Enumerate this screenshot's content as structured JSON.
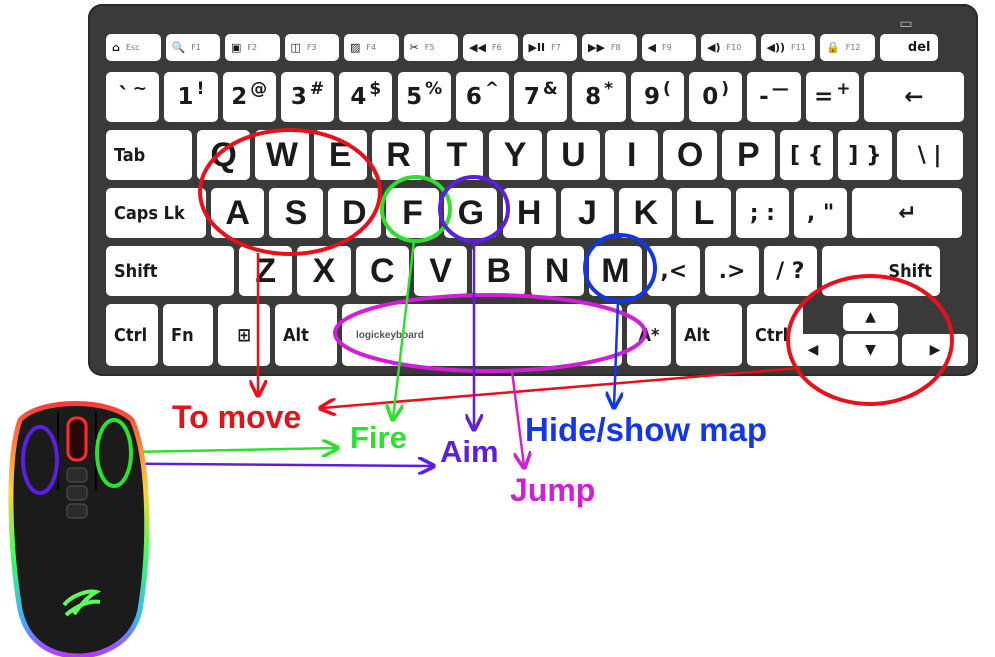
{
  "keyboard": {
    "brand": "logickeyboard",
    "function_row": [
      {
        "label": "⌂",
        "fn": "Esc",
        "icon": "home-icon"
      },
      {
        "label": "🔍",
        "fn": "F1",
        "icon": "search-icon"
      },
      {
        "label": "▣",
        "fn": "F2",
        "icon": "image-icon"
      },
      {
        "label": "◫",
        "fn": "F3",
        "icon": "window-icon"
      },
      {
        "label": "▨",
        "fn": "F4",
        "icon": "screen-edit-icon"
      },
      {
        "label": "✂",
        "fn": "F5",
        "icon": "scissors-icon"
      },
      {
        "label": "◀◀",
        "fn": "F6",
        "icon": "rewind-icon"
      },
      {
        "label": "▶II",
        "fn": "F7",
        "icon": "play-pause-icon"
      },
      {
        "label": "▶▶",
        "fn": "F8",
        "icon": "fast-forward-icon"
      },
      {
        "label": "◀",
        "fn": "F9",
        "icon": "mute-icon"
      },
      {
        "label": "◀)",
        "fn": "F10",
        "icon": "volume-down-icon"
      },
      {
        "label": "◀))",
        "fn": "F11",
        "icon": "volume-up-icon"
      },
      {
        "label": "🔒",
        "fn": "F12",
        "icon": "lock-icon"
      },
      {
        "label": "del",
        "fn": "",
        "icon": ""
      }
    ],
    "number_row": [
      {
        "main": "`",
        "shift": "~"
      },
      {
        "main": "1",
        "shift": "!"
      },
      {
        "main": "2",
        "shift": "@"
      },
      {
        "main": "3",
        "shift": "#"
      },
      {
        "main": "4",
        "shift": "$"
      },
      {
        "main": "5",
        "shift": "%"
      },
      {
        "main": "6",
        "shift": "^"
      },
      {
        "main": "7",
        "shift": "&"
      },
      {
        "main": "8",
        "shift": "*"
      },
      {
        "main": "9",
        "shift": "("
      },
      {
        "main": "0",
        "shift": ")"
      },
      {
        "main": "-",
        "shift": "—"
      },
      {
        "main": "=",
        "shift": "+"
      },
      {
        "main": "←",
        "shift": ""
      }
    ],
    "top_row": [
      "Tab",
      "Q",
      "W",
      "E",
      "R",
      "T",
      "Y",
      "U",
      "I",
      "O",
      "P",
      "[ {",
      "] }",
      "\\ |"
    ],
    "home_row": [
      "Caps Lk",
      "A",
      "S",
      "D",
      "F",
      "G",
      "H",
      "J",
      "K",
      "L",
      "; :",
      ", \"",
      "↵"
    ],
    "bottom_row": [
      "Shift",
      "Z",
      "X",
      "C",
      "V",
      "B",
      "N",
      "M",
      ",<",
      ".>",
      "/ ?",
      "Shift"
    ],
    "space_row": [
      "Ctrl",
      "Fn",
      "⊞",
      "Alt",
      "",
      "A*",
      "Alt",
      "Ctrl"
    ],
    "arrows": [
      "▲",
      "◀",
      "▼",
      "▶"
    ]
  },
  "annotations": {
    "move": {
      "text": "To move",
      "color": "#e8101a"
    },
    "fire": {
      "text": "Fire",
      "color": "#2de02d"
    },
    "aim": {
      "text": "Aim",
      "color": "#5b1fe0"
    },
    "map": {
      "text": "Hide/show map",
      "color": "#1236e8"
    },
    "jump": {
      "text": "Jump",
      "color": "#d11fd8"
    }
  }
}
